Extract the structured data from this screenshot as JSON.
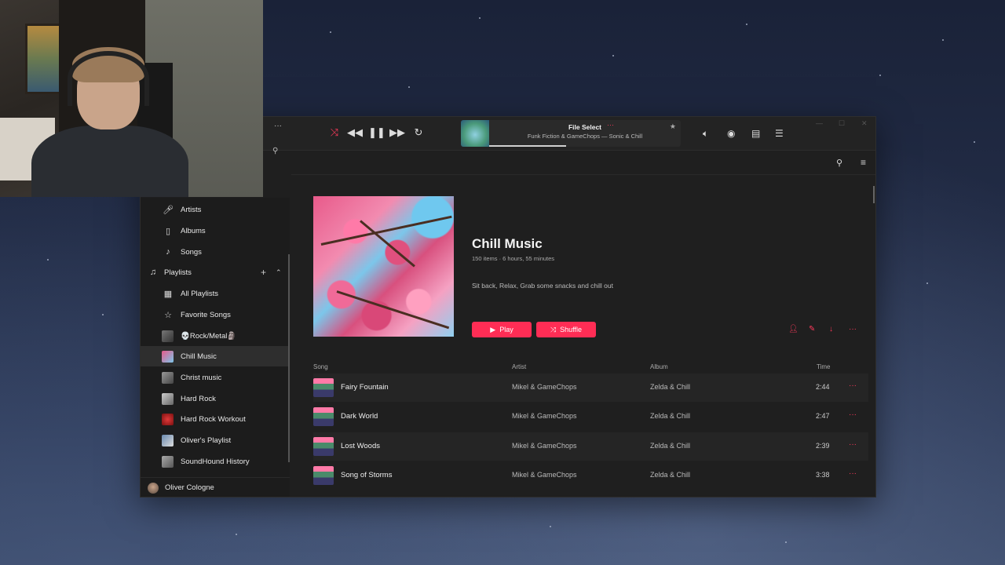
{
  "player": {
    "now_playing_title": "File Select",
    "now_playing_subtitle": "Funk Fiction & GameChops — Sonic & Chill",
    "progress": 0.4
  },
  "sidebar": {
    "items": [
      {
        "label": "Artists",
        "icon": "microphone-icon"
      },
      {
        "label": "Albums",
        "icon": "album-icon"
      },
      {
        "label": "Songs",
        "icon": "music-note-icon"
      }
    ],
    "playlists_label": "Playlists",
    "playlists": [
      {
        "label": "All Playlists",
        "icon": "grid-icon"
      },
      {
        "label": "Favorite Songs",
        "icon": "star-icon"
      },
      {
        "label": "💀Rock/Metal🗿"
      },
      {
        "label": "Chill Music",
        "active": true
      },
      {
        "label": "Christ music"
      },
      {
        "label": "Hard Rock"
      },
      {
        "label": "Hard Rock Workout"
      },
      {
        "label": "Oliver's Playlist"
      },
      {
        "label": "SoundHound History"
      }
    ],
    "user_name": "Oliver Cologne"
  },
  "playlist": {
    "title": "Chill Music",
    "meta": "150 items · 6 hours, 55 minutes",
    "description": "Sit back, Relax, Grab some snacks and chill out",
    "play_label": "Play",
    "shuffle_label": "Shuffle"
  },
  "table": {
    "headers": {
      "song": "Song",
      "artist": "Artist",
      "album": "Album",
      "time": "Time"
    },
    "rows": [
      {
        "song": "Fairy Fountain",
        "artist": "Mikel & GameChops",
        "album": "Zelda & Chill",
        "time": "2:44"
      },
      {
        "song": "Dark World",
        "artist": "Mikel & GameChops",
        "album": "Zelda & Chill",
        "time": "2:47"
      },
      {
        "song": "Lost Woods",
        "artist": "Mikel & GameChops",
        "album": "Zelda & Chill",
        "time": "2:39"
      },
      {
        "song": "Song of Storms",
        "artist": "Mikel & GameChops",
        "album": "Zelda & Chill",
        "time": "3:38"
      }
    ]
  },
  "colors": {
    "accent": "#ff2d55",
    "background": "#1f1f1f"
  }
}
